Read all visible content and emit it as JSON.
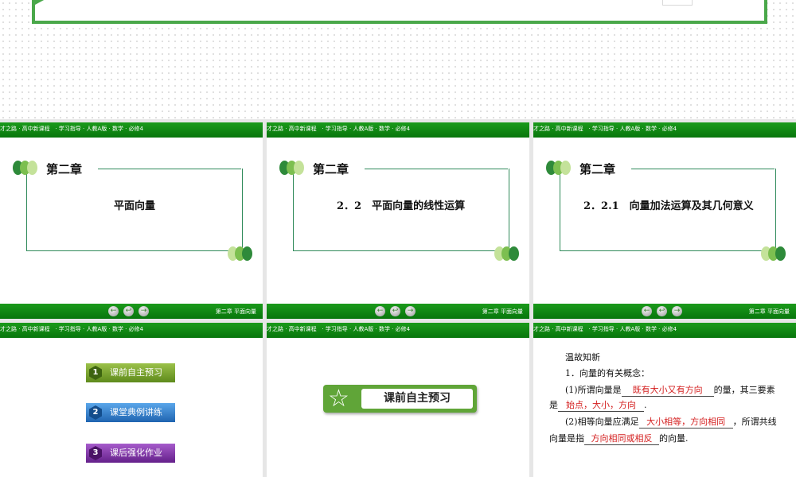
{
  "header": {
    "text": "才之路 · 高中新课程   · 学习指导 · 人教A版 · 数学 · 必修4"
  },
  "footer": {
    "chapter": "第二章    平面向量",
    "nav": [
      "←",
      "↩",
      "→"
    ]
  },
  "slides_row1": [
    {
      "chapter_label": "第二章",
      "title": "平面向量"
    },
    {
      "chapter_label": "第二章",
      "title": "2．2　平面向量的线性运算"
    },
    {
      "chapter_label": "第二章",
      "title": "2．2.1　向量加法运算及其几何意义"
    }
  ],
  "menu": [
    {
      "num": "1",
      "label": "课前自主预习",
      "color": "#6d9424"
    },
    {
      "num": "2",
      "label": "课堂典例讲练",
      "color": "#2d7cc8"
    },
    {
      "num": "3",
      "label": "课后强化作业",
      "color": "#7d2fa0"
    }
  ],
  "preview": {
    "star": "☆",
    "label": "课前自主预习"
  },
  "review": {
    "heading": "温故知新",
    "q1": "1．向量的有关概念：",
    "l1_pre": "(1)所谓向量是",
    "l1_ans": "既有大小又有方向",
    "l1_post": "的量，其三要素",
    "l2_pre": "是",
    "l2_ans": "始点，大小，方向",
    "l2_post": ".",
    "l3_pre": "(2)相等向量应满足",
    "l3_ans": "大小相等，方向相同",
    "l3_post": "，所谓共线",
    "l4_pre": "向量是指",
    "l4_ans": "方向相同或相反",
    "l4_post": "的向量."
  }
}
